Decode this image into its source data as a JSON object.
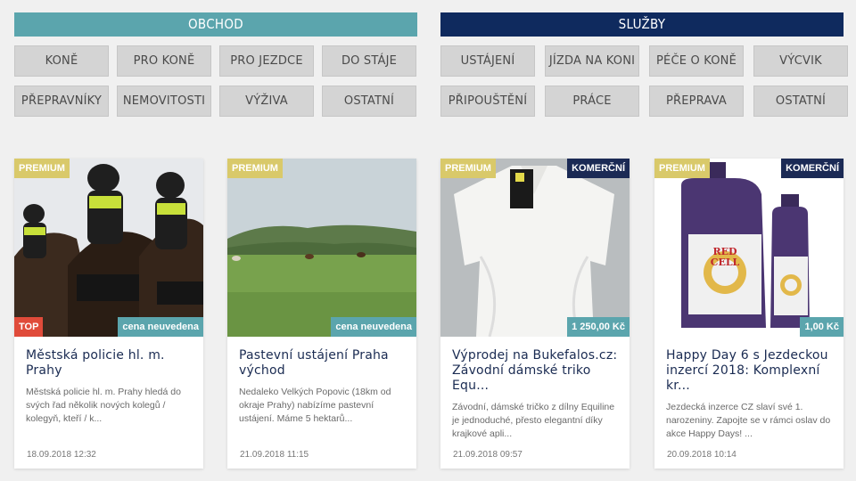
{
  "obchod": {
    "header": "OBCHOD",
    "buttons": [
      "KONĚ",
      "PRO KONĚ",
      "PRO JEZDCE",
      "DO STÁJE",
      "PŘEPRAVNÍKY",
      "NEMOVITOSTI",
      "VÝŽIVA",
      "OSTATNÍ"
    ]
  },
  "sluzby": {
    "header": "SLUŽBY",
    "buttons": [
      "USTÁJENÍ",
      "JÍZDA NA KONI",
      "PÉČE O KONĚ",
      "VÝCVIK",
      "PŘIPOUŠTĚNÍ",
      "PRÁCE",
      "PŘEPRAVA",
      "OSTATNÍ"
    ]
  },
  "cards": [
    {
      "badge_premium": "PREMIUM",
      "badge_top": "TOP",
      "price": "cena neuvedena",
      "title": "Městská policie hl. m. Prahy",
      "desc": "Městská policie hl. m. Prahy hledá do svých řad několik nových kolegů / kolegyň, kteří / k...",
      "date": "18.09.2018 12:32"
    },
    {
      "badge_premium": "PREMIUM",
      "price": "cena neuvedena",
      "title": "Pastevní ustájení Praha východ",
      "desc": "Nedaleko Velkých Popovic (18km od okraje Prahy) nabízíme pastevní ustájení. Máme 5 hektarů...",
      "date": "21.09.2018 11:15"
    },
    {
      "badge_premium": "PREMIUM",
      "badge_komercni": "KOMERČNÍ",
      "price": "1 250,00 Kč",
      "title": "Výprodej na Bukefalos.cz: Závodní dámské triko Equ...",
      "desc": "Závodní, dámské tričko z dílny Equiline je jednoduché, přesto elegantní díky krajkové apli...",
      "date": "21.09.2018 09:57"
    },
    {
      "badge_premium": "PREMIUM",
      "badge_komercni": "KOMERČNÍ",
      "price": "1,00 Kč",
      "title": "Happy Day 6 s Jezdeckou inzercí 2018: Komplexní kr...",
      "desc": "Jezdecká inzerce CZ slaví své 1. narozeniny. Zapojte se v rámci oslav do akce Happy Days! ...",
      "date": "20.09.2018 10:14",
      "bottle_brand": "RED CELL"
    }
  ]
}
